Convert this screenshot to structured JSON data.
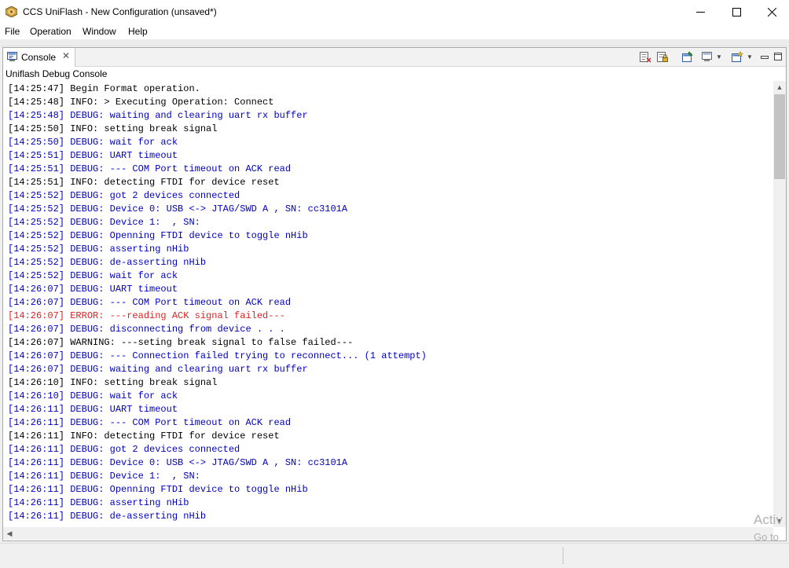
{
  "window": {
    "title": "CCS UniFlash - New Configuration (unsaved*)",
    "controls": [
      "minimize",
      "maximize",
      "close"
    ]
  },
  "menu": [
    "File",
    "Operation",
    "Window",
    "Help"
  ],
  "view": {
    "tab_label": "Console",
    "console_name": "Uniflash Debug Console",
    "toolbar_icons": [
      "clear-console-icon",
      "scroll-lock-icon",
      "pin-console-icon",
      "display-console-icon",
      "open-console-icon",
      "minimize-view-icon",
      "maximize-view-icon"
    ]
  },
  "console": {
    "colors": {
      "info": "#000000",
      "debug": "#0000c0",
      "error": "#dd2222",
      "warning": "#000000"
    },
    "lines": [
      {
        "level": "info",
        "text": "[14:25:47] Begin Format operation."
      },
      {
        "level": "info",
        "text": "[14:25:48] INFO: > Executing Operation: Connect"
      },
      {
        "level": "debug",
        "text": "[14:25:48] DEBUG: waiting and clearing uart rx buffer"
      },
      {
        "level": "info",
        "text": "[14:25:50] INFO: setting break signal"
      },
      {
        "level": "debug",
        "text": "[14:25:50] DEBUG: wait for ack"
      },
      {
        "level": "debug",
        "text": "[14:25:51] DEBUG: UART timeout"
      },
      {
        "level": "debug",
        "text": "[14:25:51] DEBUG: --- COM Port timeout on ACK read"
      },
      {
        "level": "info",
        "text": "[14:25:51] INFO: detecting FTDI for device reset"
      },
      {
        "level": "debug",
        "text": "[14:25:52] DEBUG: got 2 devices connected"
      },
      {
        "level": "debug",
        "text": "[14:25:52] DEBUG: Device 0: USB <-> JTAG/SWD A , SN: cc3101A"
      },
      {
        "level": "debug",
        "text": "[14:25:52] DEBUG: Device 1:  , SN:"
      },
      {
        "level": "debug",
        "text": "[14:25:52] DEBUG: Openning FTDI device to toggle nHib"
      },
      {
        "level": "debug",
        "text": "[14:25:52] DEBUG: asserting nHib"
      },
      {
        "level": "debug",
        "text": "[14:25:52] DEBUG: de-asserting nHib"
      },
      {
        "level": "debug",
        "text": "[14:25:52] DEBUG: wait for ack"
      },
      {
        "level": "debug",
        "text": "[14:26:07] DEBUG: UART timeout"
      },
      {
        "level": "debug",
        "text": "[14:26:07] DEBUG: --- COM Port timeout on ACK read"
      },
      {
        "level": "error",
        "text": "[14:26:07] ERROR: ---reading ACK signal failed---"
      },
      {
        "level": "debug",
        "text": "[14:26:07] DEBUG: disconnecting from device . . ."
      },
      {
        "level": "warning",
        "text": "[14:26:07] WARNING: ---seting break signal to false failed---"
      },
      {
        "level": "debug",
        "text": "[14:26:07] DEBUG: --- Connection failed trying to reconnect... (1 attempt)"
      },
      {
        "level": "debug",
        "text": "[14:26:07] DEBUG: waiting and clearing uart rx buffer"
      },
      {
        "level": "info",
        "text": "[14:26:10] INFO: setting break signal"
      },
      {
        "level": "debug",
        "text": "[14:26:10] DEBUG: wait for ack"
      },
      {
        "level": "debug",
        "text": "[14:26:11] DEBUG: UART timeout"
      },
      {
        "level": "debug",
        "text": "[14:26:11] DEBUG: --- COM Port timeout on ACK read"
      },
      {
        "level": "info",
        "text": "[14:26:11] INFO: detecting FTDI for device reset"
      },
      {
        "level": "debug",
        "text": "[14:26:11] DEBUG: got 2 devices connected"
      },
      {
        "level": "debug",
        "text": "[14:26:11] DEBUG: Device 0: USB <-> JTAG/SWD A , SN: cc3101A"
      },
      {
        "level": "debug",
        "text": "[14:26:11] DEBUG: Device 1:  , SN:"
      },
      {
        "level": "debug",
        "text": "[14:26:11] DEBUG: Openning FTDI device to toggle nHib"
      },
      {
        "level": "debug",
        "text": "[14:26:11] DEBUG: asserting nHib"
      },
      {
        "level": "debug",
        "text": "[14:26:11] DEBUG: de-asserting nHib"
      }
    ]
  },
  "watermark": {
    "line1": "Activ",
    "line2": "Go to"
  }
}
